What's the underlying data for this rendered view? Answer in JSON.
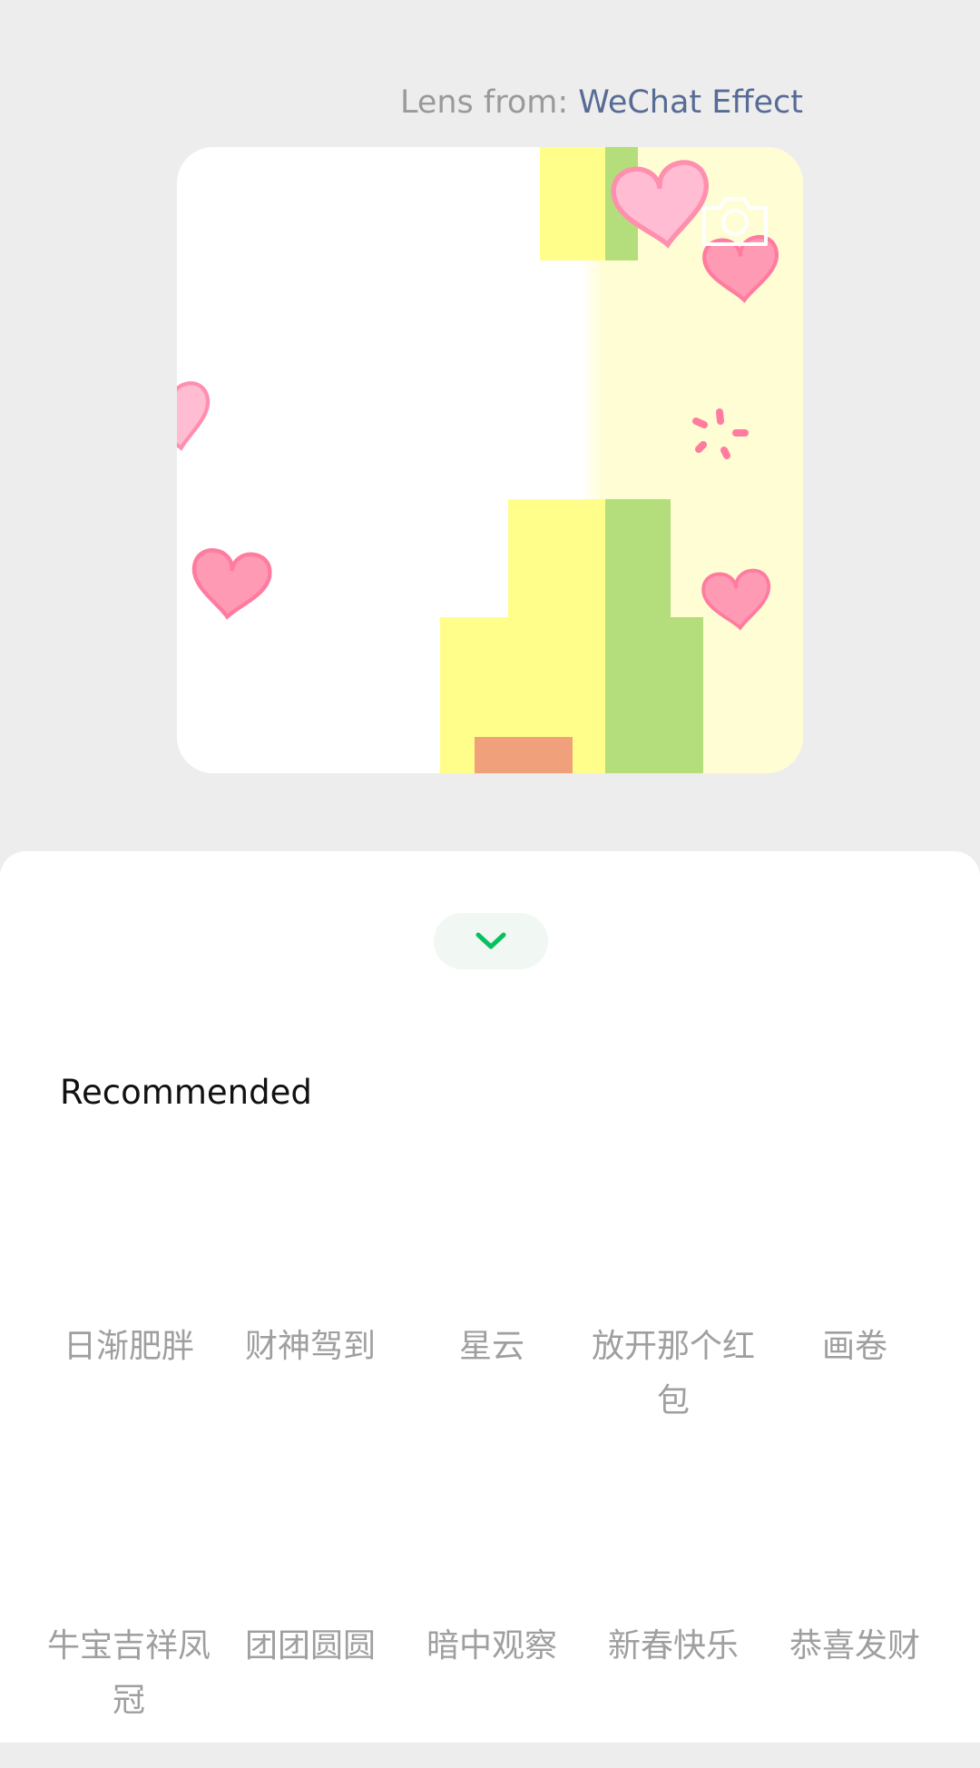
{
  "header": {
    "lens_prefix": "Lens from: ",
    "lens_name": "WeChat Effect"
  },
  "preview": {
    "camera_icon": "camera-icon",
    "decorations": [
      "heart-icon",
      "sparkle-icon"
    ]
  },
  "sheet": {
    "collapse_icon": "chevron-down-icon",
    "section_title": "Recommended",
    "effects": [
      {
        "label": "日渐肥胖"
      },
      {
        "label": "财神驾到"
      },
      {
        "label": "星云"
      },
      {
        "label": "放开那个红包"
      },
      {
        "label": "画卷"
      },
      {
        "label": "牛宝吉祥凤冠"
      },
      {
        "label": "团团圆圆"
      },
      {
        "label": "暗中观察"
      },
      {
        "label": "新春快乐"
      },
      {
        "label": "恭喜发财"
      }
    ]
  },
  "colors": {
    "background": "#ededed",
    "link": "#576b95",
    "accent": "#07c160",
    "muted_text": "#9f9f9f",
    "heart_pink": "#ff9ab5"
  }
}
